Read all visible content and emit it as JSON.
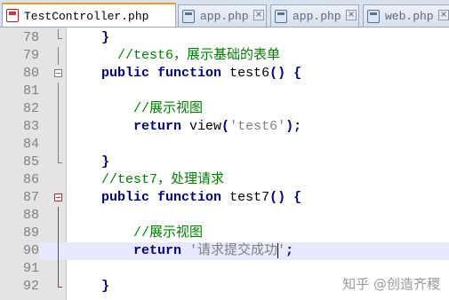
{
  "tabs": [
    {
      "label": "TestController.php",
      "active": true
    },
    {
      "label": "app.php",
      "active": false
    },
    {
      "label": "app.php",
      "active": false
    },
    {
      "label": "web.php",
      "active": false
    }
  ],
  "close_glyph": "×",
  "lines": [
    {
      "num": "78",
      "tokens": [
        {
          "t": "    "
        },
        {
          "t": "}",
          "c": "op"
        }
      ]
    },
    {
      "num": "79",
      "tokens": [
        {
          "t": "      "
        },
        {
          "t": "//test6，展示基础的表单",
          "c": "cm"
        }
      ]
    },
    {
      "num": "80",
      "tokens": [
        {
          "t": "    "
        },
        {
          "t": "public",
          "c": "kw"
        },
        {
          "t": " "
        },
        {
          "t": "function",
          "c": "kw"
        },
        {
          "t": " test6"
        },
        {
          "t": "()",
          "c": "op"
        },
        {
          "t": " "
        },
        {
          "t": "{",
          "c": "op"
        }
      ]
    },
    {
      "num": "81",
      "tokens": []
    },
    {
      "num": "82",
      "tokens": [
        {
          "t": "        "
        },
        {
          "t": "//展示视图",
          "c": "cm"
        }
      ]
    },
    {
      "num": "83",
      "tokens": [
        {
          "t": "        "
        },
        {
          "t": "return",
          "c": "kw"
        },
        {
          "t": " view"
        },
        {
          "t": "(",
          "c": "op"
        },
        {
          "t": "'test6'",
          "c": "str"
        },
        {
          "t": ");",
          "c": "op"
        }
      ]
    },
    {
      "num": "84",
      "tokens": []
    },
    {
      "num": "85",
      "tokens": [
        {
          "t": "    "
        },
        {
          "t": "}",
          "c": "op"
        }
      ]
    },
    {
      "num": "86",
      "tokens": [
        {
          "t": "    "
        },
        {
          "t": "//test7，处理请求",
          "c": "cm"
        }
      ]
    },
    {
      "num": "87",
      "tokens": [
        {
          "t": "    "
        },
        {
          "t": "public",
          "c": "kw"
        },
        {
          "t": " "
        },
        {
          "t": "function",
          "c": "kw"
        },
        {
          "t": " test7"
        },
        {
          "t": "()",
          "c": "op"
        },
        {
          "t": " "
        },
        {
          "t": "{",
          "c": "op"
        }
      ]
    },
    {
      "num": "88",
      "tokens": []
    },
    {
      "num": "89",
      "tokens": [
        {
          "t": "        "
        },
        {
          "t": "//展示视图",
          "c": "cm"
        }
      ]
    },
    {
      "num": "90",
      "tokens": [
        {
          "t": "        "
        },
        {
          "t": "return",
          "c": "kw"
        },
        {
          "t": " "
        },
        {
          "t": "'请求提交成功",
          "c": "str"
        },
        {
          "cursor": true
        },
        {
          "t": "'",
          "c": "str"
        },
        {
          "t": ";",
          "c": "op"
        }
      ],
      "current": true
    },
    {
      "num": "91",
      "tokens": []
    },
    {
      "num": "92",
      "tokens": [
        {
          "t": "    "
        },
        {
          "t": "}",
          "c": "op"
        }
      ]
    }
  ],
  "watermark": "知乎 @创造齐稷"
}
